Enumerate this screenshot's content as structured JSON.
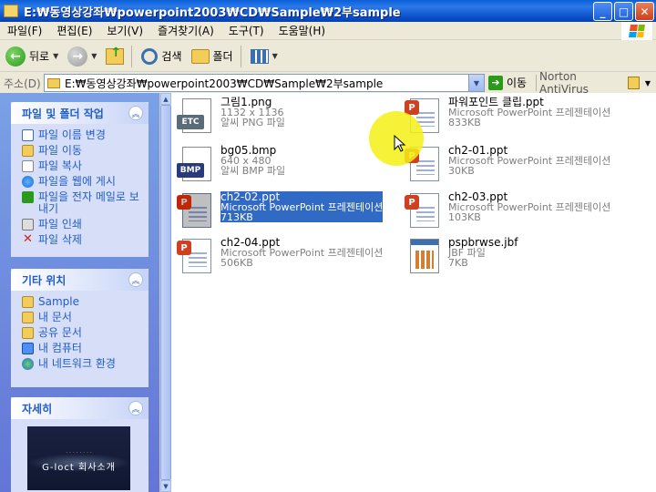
{
  "window": {
    "title": "E:₩동영상강좌₩powerpoint2003₩CD₩Sample₩2부sample"
  },
  "menu": [
    "파일(F)",
    "편집(E)",
    "보기(V)",
    "즐겨찾기(A)",
    "도구(T)",
    "도움말(H)"
  ],
  "toolbar": {
    "back_label": "뒤로",
    "search_label": "검색",
    "folders_label": "폴더"
  },
  "address": {
    "label": "주소(D)",
    "value": "E:₩동영상강좌₩powerpoint2003₩CD₩Sample₩2부sample",
    "go_label": "이동",
    "norton_label": "Norton AntiVirus"
  },
  "tasks": {
    "title": "파일 및 폴더 작업",
    "items": [
      "파일 이름 변경",
      "파일 이동",
      "파일 복사",
      "파일을 웹에 게시",
      "파일을 전자 메일로 보내기",
      "파일 인쇄",
      "파일 삭제"
    ]
  },
  "places": {
    "title": "기타 위치",
    "items": [
      "Sample",
      "내 문서",
      "공유 문서",
      "내 컴퓨터",
      "내 네트워크 환경"
    ]
  },
  "details": {
    "title": "자세히",
    "thumb_title": "G-loct 회사소개"
  },
  "files": [
    {
      "name": "그림1.png",
      "line2": "1132 x 1136",
      "line3": "알씨 PNG 파일",
      "kind": "png",
      "badge": "ETC"
    },
    {
      "name": "파워포인트 클립.ppt",
      "line2": "Microsoft PowerPoint 프레젠테이션",
      "line3": "833KB",
      "kind": "ppt"
    },
    {
      "name": "bg05.bmp",
      "line2": "640 x 480",
      "line3": "알씨 BMP 파일",
      "kind": "bmp",
      "badge": "BMP"
    },
    {
      "name": "ch2-01.ppt",
      "line2": "Microsoft PowerPoint 프레젠테이션",
      "line3": "30KB",
      "kind": "ppt"
    },
    {
      "name": "ch2-02.ppt",
      "line2": "Microsoft PowerPoint 프레젠테이션",
      "line3": "713KB",
      "kind": "ppt",
      "selected": true
    },
    {
      "name": "ch2-03.ppt",
      "line2": "Microsoft PowerPoint 프레젠테이션",
      "line3": "103KB",
      "kind": "ppt"
    },
    {
      "name": "ch2-04.ppt",
      "line2": "Microsoft PowerPoint 프레젠테이션",
      "line3": "506KB",
      "kind": "ppt"
    },
    {
      "name": "pspbrwse.jbf",
      "line2": "JBF 파일",
      "line3": "7KB",
      "kind": "jbf"
    }
  ]
}
